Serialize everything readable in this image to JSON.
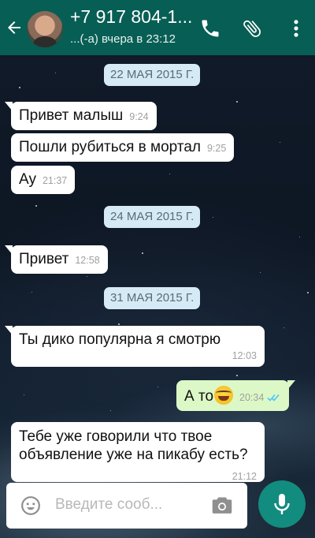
{
  "header": {
    "name": "+7 917 804-1...",
    "status": "...(-а) вчера в 23:12",
    "colors": {
      "bar": "#075e54"
    }
  },
  "messages": [
    {
      "type": "date",
      "text": "22 МАЯ 2015 Г."
    },
    {
      "type": "in",
      "text": "Привет малыш",
      "time": "9:24"
    },
    {
      "type": "in",
      "text": "Пошли рубиться в мортал",
      "time": "9:25"
    },
    {
      "type": "in",
      "text": "Ау",
      "time": "21:37"
    },
    {
      "type": "date",
      "text": "24 МАЯ 2015 Г."
    },
    {
      "type": "in",
      "text": "Привет",
      "time": "12:58"
    },
    {
      "type": "date",
      "text": "31 МАЯ 2015 Г."
    },
    {
      "type": "in",
      "text": "Ты дико популярна я смотрю",
      "time": "12:03"
    },
    {
      "type": "out",
      "text": "А то",
      "emoji": "laughing-tears-emoji",
      "time": "20:34",
      "status": "read"
    },
    {
      "type": "in",
      "text": "Тебе уже говорили что твое объявление уже на пикабу есть?",
      "time": "21:12"
    }
  ],
  "composer": {
    "placeholder": "Введите сооб..."
  },
  "icons": [
    "back-arrow-icon",
    "avatar",
    "phone-icon",
    "paperclip-icon",
    "more-vert-icon",
    "emoji-icon",
    "camera-icon",
    "mic-icon"
  ]
}
